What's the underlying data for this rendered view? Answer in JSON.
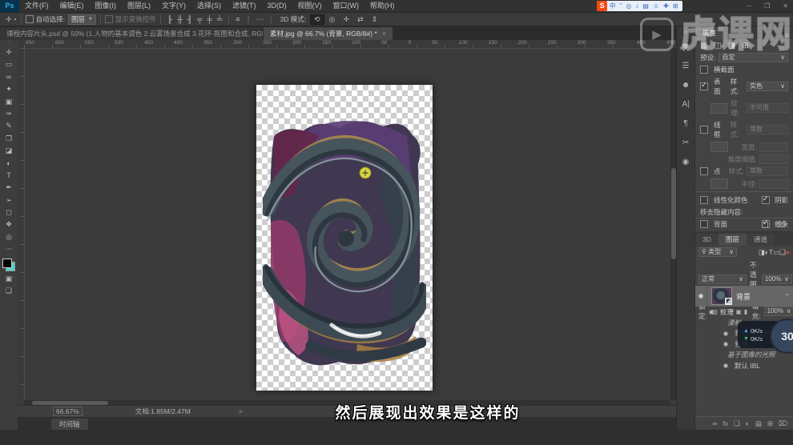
{
  "app": {
    "logo": "Ps",
    "window_buttons": [
      {
        "glyph": "─"
      },
      {
        "glyph": "❐"
      },
      {
        "glyph": "✕"
      }
    ]
  },
  "menu": {
    "items": [
      "文件(F)",
      "编辑(E)",
      "图像(I)",
      "图层(L)",
      "文字(Y)",
      "选择(S)",
      "滤镜(T)",
      "3D(D)",
      "视图(V)",
      "窗口(W)",
      "帮助(H)"
    ]
  },
  "ime": {
    "logo": "S",
    "icons": [
      {
        "glyph": "中"
      },
      {
        "glyph": "”"
      },
      {
        "glyph": "◎"
      },
      {
        "glyph": "♪"
      },
      {
        "glyph": "▤"
      },
      {
        "glyph": "☺"
      },
      {
        "glyph": "✚"
      },
      {
        "glyph": "⊞"
      }
    ]
  },
  "options": {
    "tool_glyph": "✛",
    "tool_caret": "▾",
    "auto_select_label": "自动选择:",
    "auto_select_value": "图层",
    "show_transform_label": "显示变换控件",
    "align_icons": [
      {
        "glyph": "╟"
      },
      {
        "glyph": "╫"
      },
      {
        "glyph": "╢"
      },
      {
        "glyph": "╤"
      },
      {
        "glyph": "╪"
      },
      {
        "glyph": "╧"
      }
    ],
    "distribute_icons": [
      {
        "glyph": "≡"
      },
      {
        "glyph": "⋮"
      },
      {
        "glyph": "⋯"
      }
    ],
    "mode_label": "3D 模式:",
    "mode_icons": [
      {
        "glyph": "⟲",
        "active": true
      },
      {
        "glyph": "◎"
      },
      {
        "glyph": "✛"
      },
      {
        "glyph": "⇄"
      },
      {
        "glyph": "⇕"
      }
    ]
  },
  "tabs": [
    {
      "title": "课程内容片头.psd @ 50% (1.人物的基本调色 2.云雾场景合成 3.花环-抠图和合成, RGB/8) *",
      "close": "×"
    },
    {
      "title": "素材.jpg @ 66.7% (背景, RGB/8#) *",
      "close": "×",
      "active": true
    }
  ],
  "ruler": {
    "labels": [
      "650",
      "600",
      "550",
      "500",
      "450",
      "400",
      "350",
      "300",
      "250",
      "200",
      "150",
      "100",
      "50",
      "0",
      "50",
      "100",
      "150",
      "200",
      "250",
      "300",
      "350",
      "400",
      "450"
    ]
  },
  "toolbar": {
    "grip": "⁙",
    "tools": [
      {
        "name": "move-tool",
        "glyph": "✛"
      },
      {
        "name": "marquee-tool",
        "glyph": "▭"
      },
      {
        "name": "lasso-tool",
        "glyph": "∞"
      },
      {
        "name": "quick-selection-tool",
        "glyph": "✦"
      },
      {
        "name": "crop-tool",
        "glyph": "▣"
      },
      {
        "name": "eyedropper-tool",
        "glyph": "✑"
      },
      {
        "name": "brush-tool",
        "glyph": "✎"
      },
      {
        "name": "clone-stamp-tool",
        "glyph": "❐"
      },
      {
        "name": "eraser-tool",
        "glyph": "◪"
      },
      {
        "name": "dodge-tool",
        "glyph": "◐"
      },
      {
        "name": "type-tool",
        "glyph": "T"
      },
      {
        "name": "pen-tool",
        "glyph": "✒"
      },
      {
        "name": "path-selection-tool",
        "glyph": "➢"
      },
      {
        "name": "shape-tool",
        "glyph": "◻"
      },
      {
        "name": "hand-tool",
        "glyph": "❖"
      },
      {
        "name": "zoom-tool",
        "glyph": "◎"
      }
    ],
    "more_glyph": "⋯",
    "bg_color": "#4dd2cf",
    "quickmask_glyph": "▣",
    "screenmode_glyph": "❏"
  },
  "panel_strip": {
    "collapse_glyph": "«",
    "icons": [
      {
        "glyph": "✾"
      },
      {
        "glyph": "☰"
      },
      {
        "glyph": "☻"
      },
      {
        "glyph": "A|"
      },
      {
        "glyph": "¶"
      },
      {
        "glyph": "✂"
      },
      {
        "glyph": "◉"
      }
    ]
  },
  "props": {
    "tab": "属性",
    "menu_glyph": "≡",
    "subtabs": [
      {
        "glyph": "▦"
      },
      {
        "glyph": "◫"
      },
      {
        "glyph": "◨"
      },
      {
        "glyph": "⊞"
      }
    ],
    "preset_label": "预设:",
    "preset_value": "自定",
    "caret": "∨",
    "cross_section_label": "横截面",
    "cross_section_checked": false,
    "surface_label": "表面",
    "surface_checked": true,
    "style_label": "样式:",
    "surface_style": "实色",
    "texture_label": "纹理:",
    "texture_value": "不可用",
    "wireframe_label": "线框",
    "wireframe_checked": false,
    "wire_style": "常数",
    "width_label": "宽度:",
    "angle_label": "角度阈值:",
    "points_label": "点",
    "points_checked": false,
    "point_style": "常数",
    "radius_label": "半径:",
    "linearize_label": "线性化颜色",
    "linearize_checked": false,
    "shadow_label": "阴影",
    "shadow_checked": true,
    "remove_hidden_label": "移去隐藏内容:",
    "backface_label": "背面",
    "backface_checked": false,
    "lines_label": "线条",
    "lines_checked": true,
    "footer_icons": [
      {
        "glyph": "❒"
      },
      {
        "glyph": "⌦"
      }
    ]
  },
  "layers": {
    "tabs": [
      {
        "label": "3D"
      },
      {
        "label": "图层",
        "active": true
      },
      {
        "label": "通道"
      }
    ],
    "search_glyph": "⚲",
    "filter_value": "类型",
    "caret": "∨",
    "filter_icons": [
      {
        "glyph": "◨"
      },
      {
        "glyph": "◐"
      },
      {
        "glyph": "T"
      },
      {
        "glyph": "▭"
      },
      {
        "glyph": "❏"
      },
      {
        "glyph": "●",
        "red": true
      }
    ],
    "blend_mode": "正常",
    "opacity_label": "不透明度:",
    "opacity_value": "100%",
    "lock_label": "锁定:",
    "lock_icons": [
      {
        "glyph": "▨"
      },
      {
        "glyph": "✎"
      },
      {
        "glyph": "✛"
      },
      {
        "glyph": "▣"
      },
      {
        "glyph": "▮"
      }
    ],
    "fill_label": "填充:",
    "fill_value": "100%",
    "selected_layer": {
      "eye": "◉",
      "name": "背景",
      "chevron": "⌃",
      "badge": "◩"
    },
    "rows": [
      {
        "eye": "◉",
        "name": "纹理",
        "indent": 1
      },
      {
        "eye": "",
        "name": "漫射",
        "italic": true,
        "indent": 2
      },
      {
        "eye": "◉",
        "name": "背景 深度映射",
        "indent": 3
      },
      {
        "eye": "◉",
        "name": "背景",
        "indent": 3
      },
      {
        "eye": "",
        "name": "基于图像的光照",
        "italic": true,
        "indent": 2
      },
      {
        "eye": "◉",
        "name": "默认 IBL",
        "indent": 3
      }
    ],
    "footer_icons": [
      {
        "glyph": "∞"
      },
      {
        "glyph": "fx"
      },
      {
        "glyph": "❏"
      },
      {
        "glyph": "◐"
      },
      {
        "glyph": "▤"
      },
      {
        "glyph": "⊞"
      },
      {
        "glyph": "⌦"
      }
    ]
  },
  "status": {
    "zoom": "66.67%",
    "doc": "文档:1.85M/2.47M",
    "chevron": ">",
    "timeline": "时间轴"
  },
  "overlay": {
    "up_arrow": "▲",
    "up": "0K/s",
    "down_arrow": "▼",
    "down": "0K/s",
    "badge": "30"
  },
  "subtitle": "然后展现出效果是这样的",
  "watermark": {
    "play": "▶",
    "text": "虎课网"
  },
  "colors": {
    "canvas_bg": "#3b3b3b",
    "accent_cyan": "#4dd2cf",
    "swirl_dark": "#46545c",
    "magenta": "#8d3a68",
    "gold": "#a8894e"
  }
}
